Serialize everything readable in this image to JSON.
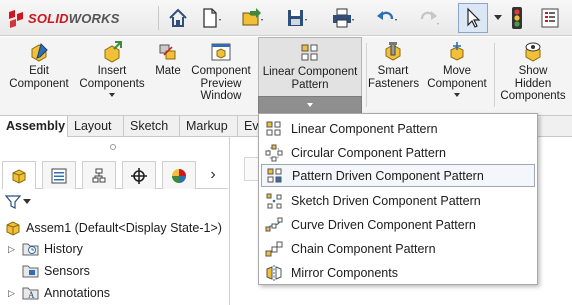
{
  "app": {
    "brand_prefix": "3S",
    "brand_solid": "SOLID",
    "brand_works": "WORKS"
  },
  "quick_access": [
    {
      "name": "home-icon"
    },
    {
      "name": "new-document-icon"
    },
    {
      "name": "open-icon"
    },
    {
      "name": "save-icon"
    },
    {
      "name": "print-icon"
    },
    {
      "name": "undo-icon"
    },
    {
      "name": "redo-icon"
    },
    {
      "name": "select-icon"
    },
    {
      "name": "traffic-light-icon"
    },
    {
      "name": "file-properties-icon"
    }
  ],
  "command_manager": {
    "edit_component": {
      "line1": "Edit",
      "line2": "Component"
    },
    "insert_components": {
      "line1": "Insert",
      "line2": "Components"
    },
    "mate": {
      "line1": "Mate"
    },
    "component_preview": {
      "line1": "Component",
      "line2": "Preview",
      "line3": "Window"
    },
    "linear_component_pattern": {
      "line1": "Linear Component",
      "line2": "Pattern"
    },
    "smart_fasteners": {
      "line1": "Smart",
      "line2": "Fasteners"
    },
    "move_component": {
      "line1": "Move",
      "line2": "Component"
    },
    "show_hidden": {
      "line1": "Show",
      "line2": "Hidden",
      "line3": "Components"
    }
  },
  "tabs": [
    {
      "label": "Assembly",
      "active": true
    },
    {
      "label": "Layout"
    },
    {
      "label": "Sketch"
    },
    {
      "label": "Markup"
    },
    {
      "label": "Ev"
    }
  ],
  "feature_tree": {
    "root": "Assem1  (Default<Display State-1>)",
    "items": [
      "History",
      "Sensors",
      "Annotations"
    ]
  },
  "pattern_menu": {
    "items": [
      {
        "label": "Linear Component Pattern",
        "icon": "linear-pattern-icon"
      },
      {
        "label": "Circular Component Pattern",
        "icon": "circular-pattern-icon"
      },
      {
        "label": "Pattern Driven Component Pattern",
        "icon": "pattern-driven-icon",
        "hover": true
      },
      {
        "label": "Sketch Driven Component Pattern",
        "icon": "sketch-driven-icon"
      },
      {
        "label": "Curve Driven Component Pattern",
        "icon": "curve-driven-icon"
      },
      {
        "label": "Chain Component Pattern",
        "icon": "chain-pattern-icon"
      },
      {
        "label": "Mirror Components",
        "icon": "mirror-components-icon"
      }
    ]
  },
  "colors": {
    "brand_red": "#d0151c",
    "icon_yellow": "#f2c037",
    "icon_blue": "#2f6db5"
  }
}
